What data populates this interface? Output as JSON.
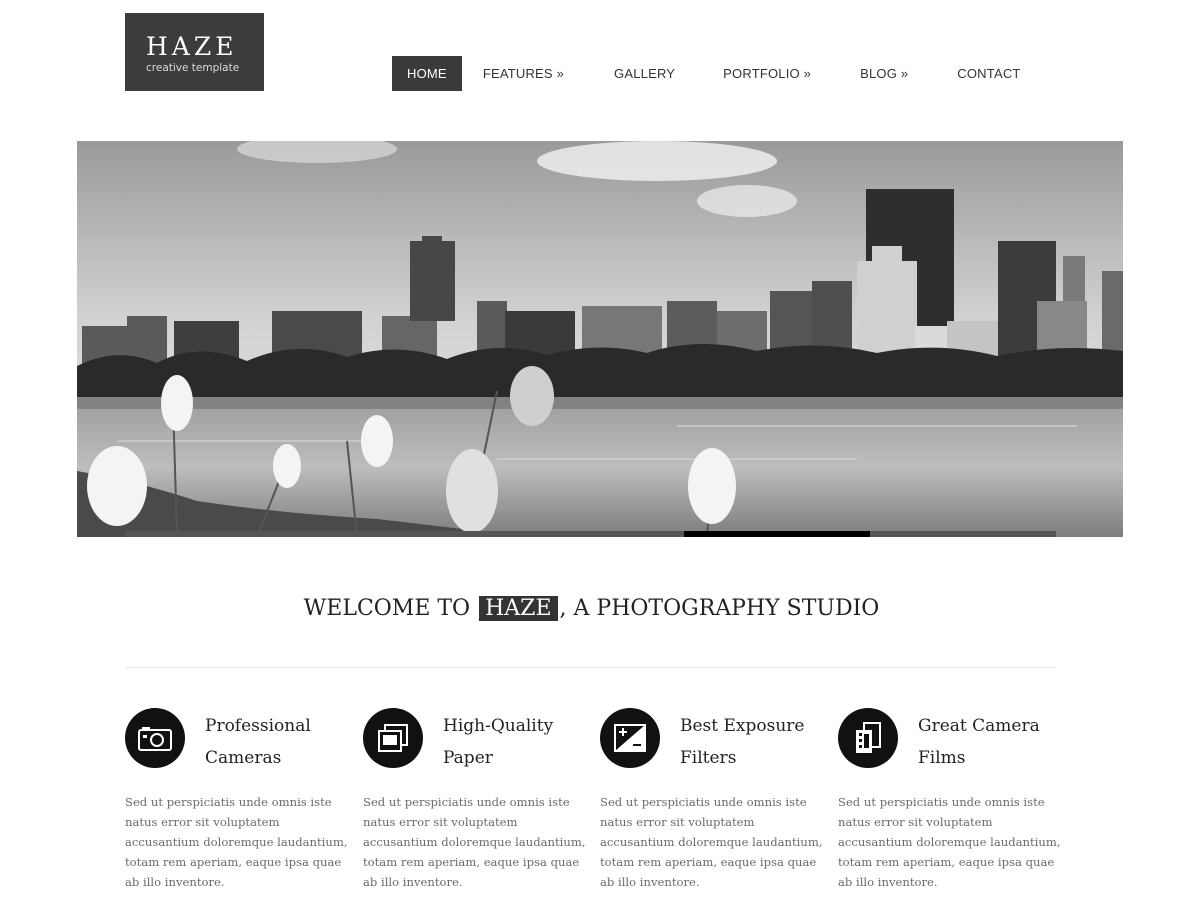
{
  "logo": {
    "name": "HAZE",
    "tagline": "creative template"
  },
  "nav": [
    {
      "label": "HOME",
      "active": true
    },
    {
      "label": "FEATURES »"
    },
    {
      "label": "GALLERY"
    },
    {
      "label": "PORTFOLIO »"
    },
    {
      "label": "BLOG »"
    },
    {
      "label": "CONTACT"
    }
  ],
  "hero": {
    "image": "city-skyline-lake-photo"
  },
  "welcome": {
    "prefix": "WELCOME TO",
    "highlight": "HAZE",
    "suffix": ", A PHOTOGRAPHY STUDIO"
  },
  "features": [
    {
      "icon": "camera-icon",
      "title": "Professional Cameras",
      "text": "Sed ut perspiciatis unde omnis iste natus error sit voluptatem accusantium doloremque laudantium, totam rem aperiam, eaque ipsa quae ab illo inventore."
    },
    {
      "icon": "photos-icon",
      "title": "High-Quality Paper",
      "text": "Sed ut perspiciatis unde omnis iste natus error sit voluptatem accusantium doloremque laudantium, totam rem aperiam, eaque ipsa quae ab illo inventore."
    },
    {
      "icon": "exposure-icon",
      "title": "Best Exposure Filters",
      "text": "Sed ut perspiciatis unde omnis iste natus error sit voluptatem accusantium doloremque laudantium, totam rem aperiam, eaque ipsa quae ab illo inventore."
    },
    {
      "icon": "film-icon",
      "title": "Great Camera Films",
      "text": "Sed ut perspiciatis unde omnis iste natus error sit voluptatem accusantium doloremque laudantium, totam rem aperiam, eaque ipsa quae ab illo inventore."
    }
  ]
}
